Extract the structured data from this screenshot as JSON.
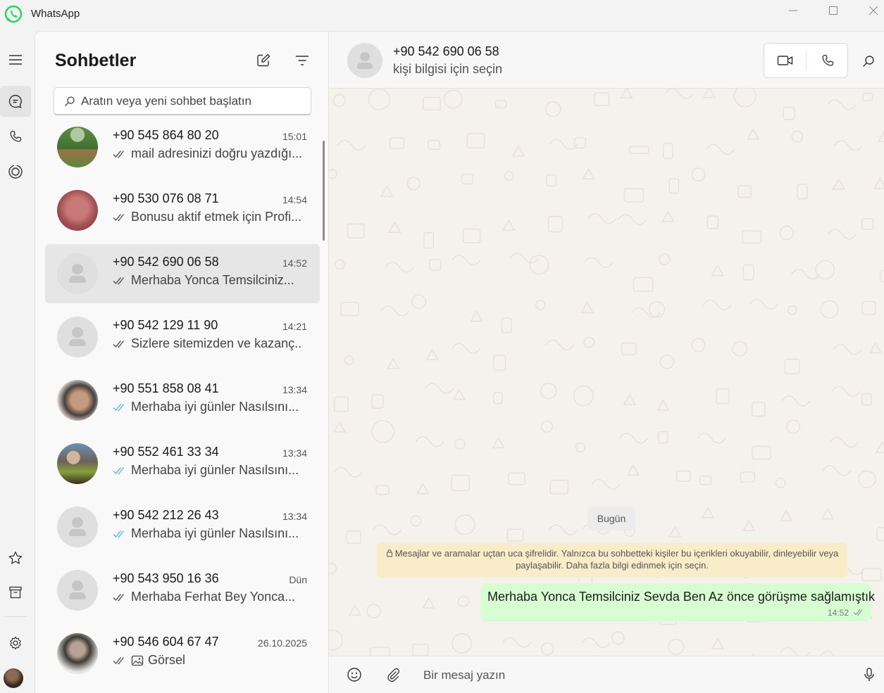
{
  "app": {
    "title": "WhatsApp",
    "accent": "#25D366"
  },
  "window_controls": [
    "minimize-icon",
    "maximize-icon",
    "close-icon"
  ],
  "rail": {
    "items": [
      "menu-icon",
      "chats-icon",
      "calls-icon",
      "status-icon"
    ],
    "bottom_items": [
      "starred-icon",
      "archive-icon",
      "settings-icon",
      "profile-avatar"
    ],
    "active": "chats-icon"
  },
  "chat_list": {
    "title": "Sohbetler",
    "search_placeholder": "Aratın veya yeni sohbet başlatın",
    "chats": [
      {
        "name": "+90 545 864 80 20",
        "time": "15:01",
        "preview": "mail adresinizi doğru yazdığı...",
        "tick": "sent-read-grey",
        "avatar": "photo"
      },
      {
        "name": "+90 530 076 08 71",
        "time": "14:54",
        "preview": "Bonusu aktif etmek için Profi...",
        "tick": "sent-read-grey",
        "avatar": "photo"
      },
      {
        "name": "+90 542 690 06 58",
        "time": "14:52",
        "preview": "Merhaba Yonca Temsilciniz...",
        "tick": "sent-read-grey",
        "avatar": "default",
        "selected": true
      },
      {
        "name": "+90 542 129 11 90",
        "time": "14:21",
        "preview": "Sizlere sitemizden ve kazanç...",
        "tick": "sent-read-grey",
        "avatar": "default"
      },
      {
        "name": "+90 551 858 08 41",
        "time": "13:34",
        "preview": "Merhaba iyi günler Nasılsını...",
        "tick": "read-blue",
        "avatar": "photo"
      },
      {
        "name": "+90 552 461 33 34",
        "time": "13:34",
        "preview": "Merhaba iyi günler Nasılsını...",
        "tick": "read-blue",
        "avatar": "photo"
      },
      {
        "name": "+90 542 212 26 43",
        "time": "13:34",
        "preview": "Merhaba iyi günler Nasılsını...",
        "tick": "read-blue",
        "avatar": "default"
      },
      {
        "name": "+90 543 950 16 36",
        "time": "Dün",
        "preview": "Merhaba Ferhat Bey  Yonca...",
        "tick": "sent-read-grey",
        "avatar": "default"
      },
      {
        "name": "+90 546 604 67 47",
        "time": "26.10.2025",
        "preview": "Görsel",
        "tick": "sent-read-grey",
        "avatar": "photo",
        "media_icon": "image-icon"
      }
    ]
  },
  "conversation": {
    "contact_name": "+90 542 690 06 58",
    "contact_sub": "kişi bilgisi için seçin",
    "day_label": "Bugün",
    "encryption_note": "Mesajlar ve aramalar uçtan uca şifrelidir. Yalnızca bu sohbetteki kişiler bu içerikleri okuyabilir, dinleyebilir veya paylaşabilir. Daha fazla bilgi edinmek için seçin.",
    "messages": [
      {
        "text": "Merhaba Yonca Temsilciniz Sevda Ben Az önce görüşme sağlamıştık",
        "time": "14:52",
        "outgoing": true
      }
    ],
    "composer_placeholder": "Bir mesaj yazın"
  },
  "colors": {
    "outgoing_bubble": "#D9FDD3",
    "read_tick": "#53BDEB",
    "encryption_note_bg": "#F9ECC9",
    "wallpaper": "#F5F1EC"
  }
}
